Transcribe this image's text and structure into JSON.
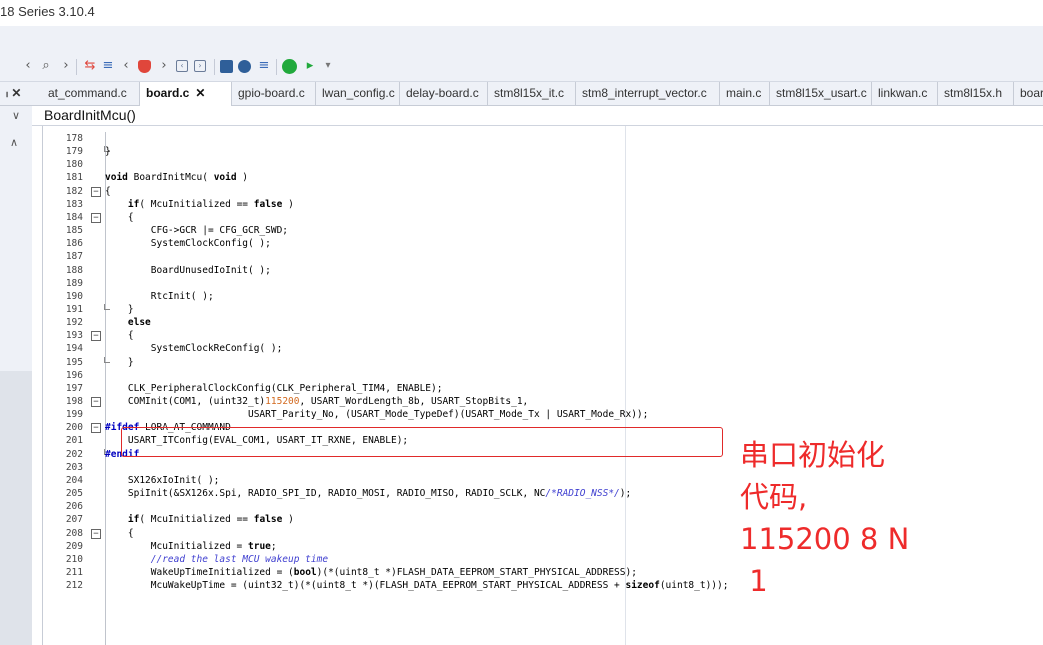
{
  "window": {
    "title": "18 Series 3.10.4"
  },
  "tabs": [
    {
      "label": "at_command.c",
      "active": false
    },
    {
      "label": "board.c",
      "active": true,
      "close": "✕"
    },
    {
      "label": "gpio-board.c",
      "active": false
    },
    {
      "label": "lwan_config.c",
      "active": false
    },
    {
      "label": "delay-board.c",
      "active": false
    },
    {
      "label": "stm8l15x_it.c",
      "active": false
    },
    {
      "label": "stm8_interrupt_vector.c",
      "active": false
    },
    {
      "label": "main.c",
      "active": false
    },
    {
      "label": "stm8l15x_usart.c",
      "active": false
    },
    {
      "label": "linkwan.c",
      "active": false
    },
    {
      "label": "stm8l15x.h",
      "active": false
    },
    {
      "label": "boar",
      "active": false
    }
  ],
  "side_close": "ₗ ✕",
  "nav": {
    "chevron": "∨",
    "function": "BoardInitMcu()"
  },
  "panel": {
    "up": "∧"
  },
  "icons": {
    "back": "back-icon",
    "search": "search-icon",
    "forward": "forward-icon",
    "accent": "#ee2b2b",
    "highlight": "#e02a2a"
  },
  "code": [
    {
      "n": "178",
      "fold": "",
      "t": ""
    },
    {
      "n": "179",
      "fold": "end",
      "t": "}"
    },
    {
      "n": "180",
      "fold": "",
      "t": ""
    },
    {
      "n": "181",
      "fold": "",
      "t": "void BoardInitMcu( void )"
    },
    {
      "n": "182",
      "fold": "box",
      "t": "{"
    },
    {
      "n": "183",
      "fold": "",
      "t": "    if( McuInitialized == false )"
    },
    {
      "n": "184",
      "fold": "box",
      "t": "    {"
    },
    {
      "n": "185",
      "fold": "",
      "t": "        CFG->GCR |= CFG_GCR_SWD;"
    },
    {
      "n": "186",
      "fold": "",
      "t": "        SystemClockConfig( );"
    },
    {
      "n": "187",
      "fold": "",
      "t": ""
    },
    {
      "n": "188",
      "fold": "",
      "t": "        BoardUnusedIoInit( );"
    },
    {
      "n": "189",
      "fold": "",
      "t": ""
    },
    {
      "n": "190",
      "fold": "",
      "t": "        RtcInit( );"
    },
    {
      "n": "191",
      "fold": "end",
      "t": "    }"
    },
    {
      "n": "192",
      "fold": "",
      "t": "    else"
    },
    {
      "n": "193",
      "fold": "box",
      "t": "    {"
    },
    {
      "n": "194",
      "fold": "",
      "t": "        SystemClockReConfig( );"
    },
    {
      "n": "195",
      "fold": "end",
      "t": "    }"
    },
    {
      "n": "196",
      "fold": "",
      "t": ""
    },
    {
      "n": "197",
      "fold": "",
      "t": "    CLK_PeripheralClockConfig(CLK_Peripheral_TIM4, ENABLE);"
    },
    {
      "n": "198",
      "fold": "box",
      "t": "    COMInit(COM1, (uint32_t)115200, USART_WordLength_8b, USART_StopBits_1,"
    },
    {
      "n": "199",
      "fold": "",
      "t": "                         USART_Parity_No, (USART_Mode_TypeDef)(USART_Mode_Tx | USART_Mode_Rx));"
    },
    {
      "n": "200",
      "fold": "box",
      "t": "#ifdef LORA_AT_COMMAND"
    },
    {
      "n": "201",
      "fold": "",
      "t": "    USART_ITConfig(EVAL_COM1, USART_IT_RXNE, ENABLE);"
    },
    {
      "n": "202",
      "fold": "end",
      "t": "#endif"
    },
    {
      "n": "203",
      "fold": "",
      "t": ""
    },
    {
      "n": "204",
      "fold": "",
      "t": "    SX126xIoInit( );"
    },
    {
      "n": "205",
      "fold": "",
      "t": "    SpiInit(&SX126x.Spi, RADIO_SPI_ID, RADIO_MOSI, RADIO_MISO, RADIO_SCLK, NC/*RADIO_NSS*/);"
    },
    {
      "n": "206",
      "fold": "",
      "t": ""
    },
    {
      "n": "207",
      "fold": "",
      "t": "    if( McuInitialized == false )"
    },
    {
      "n": "208",
      "fold": "box",
      "t": "    {"
    },
    {
      "n": "209",
      "fold": "",
      "t": "        McuInitialized = true;"
    },
    {
      "n": "210",
      "fold": "",
      "t": "        //read the last MCU wakeup time"
    },
    {
      "n": "211",
      "fold": "",
      "t": "        WakeUpTimeInitialized = (bool)(*(uint8_t *)FLASH_DATA_EEPROM_START_PHYSICAL_ADDRESS);"
    },
    {
      "n": "212",
      "fold": "",
      "t": "        McuWakeUpTime = (uint32_t)(*(uint8_t *)(FLASH_DATA_EEPROM_START_PHYSICAL_ADDRESS + sizeof(uint8_t)));"
    }
  ],
  "annotation": "串口初始化\n代码,\n115200 8 N\n 1"
}
